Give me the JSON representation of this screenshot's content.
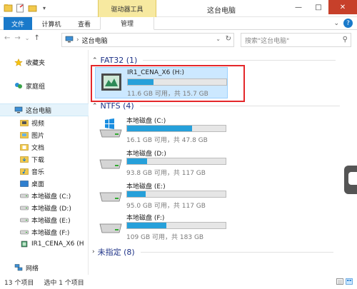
{
  "titlebar": {
    "context_tab": "驱动器工具",
    "title": "这台电脑",
    "minimize": "—",
    "maximize": "□",
    "close": "✕"
  },
  "ribbon": {
    "tabs": [
      "文件",
      "计算机",
      "查看",
      "管理"
    ],
    "help": "?"
  },
  "nav": {
    "back": "←",
    "forward": "→",
    "dropdown": "⌄",
    "up": "↑"
  },
  "address": {
    "path": "这台电脑",
    "sep": "›",
    "dropdown": "⌄",
    "refresh": "↻"
  },
  "search": {
    "placeholder": "搜索\"这台电脑\"",
    "icon": "⚲"
  },
  "sidebar": {
    "items": [
      {
        "label": "收藏夹",
        "icon": "star-icon"
      },
      {
        "label": "家庭组",
        "icon": "homegroup-icon"
      },
      {
        "label": "这台电脑",
        "icon": "computer-icon"
      },
      {
        "label": "视频",
        "icon": "video-folder-icon"
      },
      {
        "label": "图片",
        "icon": "pictures-folder-icon"
      },
      {
        "label": "文档",
        "icon": "documents-folder-icon"
      },
      {
        "label": "下载",
        "icon": "downloads-folder-icon"
      },
      {
        "label": "音乐",
        "icon": "music-folder-icon"
      },
      {
        "label": "桌面",
        "icon": "desktop-folder-icon"
      },
      {
        "label": "本地磁盘 (C:)",
        "icon": "disk-icon"
      },
      {
        "label": "本地磁盘 (D:)",
        "icon": "disk-icon"
      },
      {
        "label": "本地磁盘 (E:)",
        "icon": "disk-icon"
      },
      {
        "label": "本地磁盘 (F:)",
        "icon": "disk-icon"
      },
      {
        "label": "IR1_CENA_X6 (H",
        "icon": "usb-drive-icon"
      },
      {
        "label": "网络",
        "icon": "network-icon"
      }
    ]
  },
  "groups": [
    {
      "label": "FAT32 (1)"
    },
    {
      "label": "NTFS (4)"
    },
    {
      "label": "未指定 (8)"
    }
  ],
  "drives": [
    {
      "name": "IR1_CENA_X6 (H:)",
      "free": "11.6 GB 可用，共 15.7 GB",
      "used_fraction": 0.26,
      "icon": "usb-drive-icon"
    },
    {
      "name": "本地磁盘 (C:)",
      "free": "16.1 GB 可用，共 47.8 GB",
      "used_fraction": 0.66,
      "icon": "windows-disk-icon"
    },
    {
      "name": "本地磁盘 (D:)",
      "free": "93.8 GB 可用，共 117 GB",
      "used_fraction": 0.2,
      "icon": "disk-icon"
    },
    {
      "name": "本地磁盘 (E:)",
      "free": "95.0 GB 可用，共 117 GB",
      "used_fraction": 0.19,
      "icon": "disk-icon"
    },
    {
      "name": "本地磁盘 (F:)",
      "free": "109 GB 可用，共 183 GB",
      "used_fraction": 0.4,
      "icon": "disk-icon"
    }
  ],
  "status": {
    "count": "13 个项目",
    "selected": "选中 1 个项目"
  },
  "colors": {
    "accent": "#1979ca",
    "bar_fill": "#26a0da",
    "highlight": "#e4272a",
    "selection": "#cce8ff"
  }
}
